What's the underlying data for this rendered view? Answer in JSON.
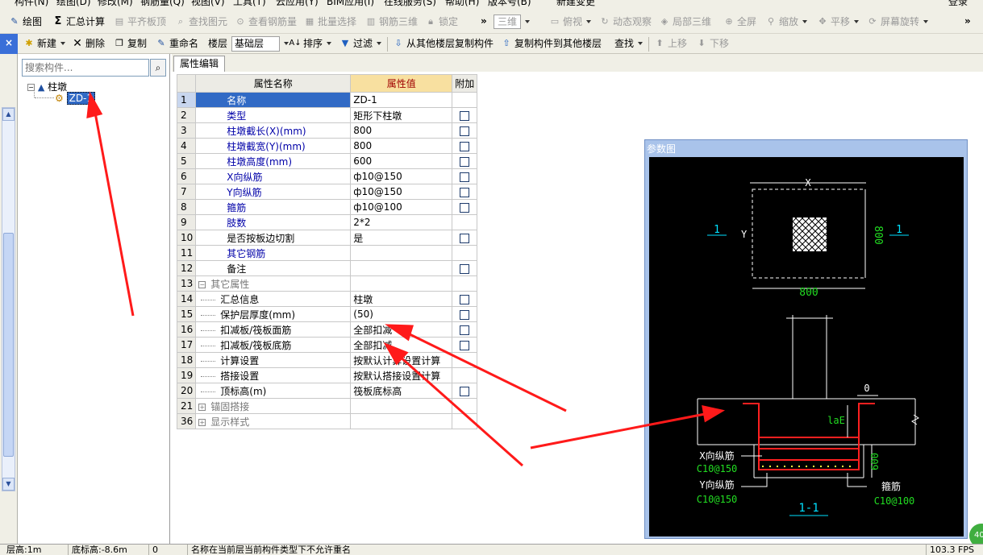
{
  "menubar": {
    "items": [
      "构件(N)",
      "绘图(D)",
      "修改(M)",
      "钢筋量(Q)",
      "视图(V)",
      "工具(T)",
      "云应用(Y)",
      "BIM应用(I)",
      "在线服务(S)",
      "帮助(H)",
      "版本号(B)",
      "新建变更"
    ],
    "login": "登录"
  },
  "toolbar1": {
    "draw": "绘图",
    "sum": "汇总计算",
    "flush_slab": "平齐板顶",
    "find_element": "查找图元",
    "view_rebar": "查看钢筋量",
    "batch_select": "批量选择",
    "rebar_3d": "钢筋三维",
    "lock": "锁定",
    "view_mode": "三维",
    "top_view": "俯视",
    "dyn_view": "动态观察",
    "local_3d": "局部三维",
    "fullscreen": "全屏",
    "zoom": "缩放",
    "pan": "平移",
    "rotate": "屏幕旋转"
  },
  "toolbar2": {
    "new": "新建",
    "delete": "删除",
    "copy": "复制",
    "rename": "重命名",
    "floor_label": "楼层",
    "floor_value": "基础层",
    "sort": "排序",
    "filter": "过滤",
    "copy_from": "从其他楼层复制构件",
    "copy_to": "复制构件到其他楼层",
    "find": "查找",
    "move_up": "上移",
    "move_down": "下移"
  },
  "tree": {
    "search_placeholder": "搜索构件...",
    "root": "柱墩",
    "child": "ZD-1"
  },
  "tab": {
    "label": "属性编辑"
  },
  "grid": {
    "headers": [
      "属性名称",
      "属性值",
      "附加"
    ],
    "rows": [
      {
        "num": "1",
        "name": "名称",
        "value": "ZD-1",
        "blue": true,
        "check": false,
        "sel": true
      },
      {
        "num": "2",
        "name": "类型",
        "value": "矩形下柱墩",
        "blue": true,
        "check": true
      },
      {
        "num": "3",
        "name": "柱墩截长(X)(mm)",
        "value": "800",
        "blue": true,
        "check": true
      },
      {
        "num": "4",
        "name": "柱墩截宽(Y)(mm)",
        "value": "800",
        "blue": true,
        "check": true
      },
      {
        "num": "5",
        "name": "柱墩高度(mm)",
        "value": "600",
        "blue": true,
        "check": true
      },
      {
        "num": "6",
        "name": "X向纵筋",
        "value": "ф10@150",
        "blue": true,
        "check": true
      },
      {
        "num": "7",
        "name": "Y向纵筋",
        "value": "ф10@150",
        "blue": true,
        "check": true
      },
      {
        "num": "8",
        "name": "箍筋",
        "value": "ф10@100",
        "blue": true,
        "check": true
      },
      {
        "num": "9",
        "name": "肢数",
        "value": "2*2",
        "blue": true,
        "check": false
      },
      {
        "num": "10",
        "name": "是否按板边切割",
        "value": "是",
        "blue": false,
        "check": true
      },
      {
        "num": "11",
        "name": "其它钢筋",
        "value": "",
        "blue": true,
        "check": false
      },
      {
        "num": "12",
        "name": "备注",
        "value": "",
        "blue": false,
        "check": true
      },
      {
        "num": "13",
        "name": "其它属性",
        "value": "",
        "group": "minus",
        "gray": true,
        "check": false
      },
      {
        "num": "14",
        "name": "汇总信息",
        "value": "柱墩",
        "child": true,
        "check": true
      },
      {
        "num": "15",
        "name": "保护层厚度(mm)",
        "value": "(50)",
        "child": true,
        "check": true
      },
      {
        "num": "16",
        "name": "扣减板/筏板面筋",
        "value": "全部扣减",
        "child": true,
        "check": true
      },
      {
        "num": "17",
        "name": "扣减板/筏板底筋",
        "value": "全部扣减",
        "child": true,
        "check": true
      },
      {
        "num": "18",
        "name": "计算设置",
        "value": "按默认计算设置计算",
        "child": true,
        "check": false
      },
      {
        "num": "19",
        "name": "搭接设置",
        "value": "按默认搭接设置计算",
        "child": true,
        "check": false
      },
      {
        "num": "20",
        "name": "顶标高(m)",
        "value": "筏板底标高",
        "child": true,
        "check": true
      },
      {
        "num": "21",
        "name": "锚固搭接",
        "value": "",
        "group": "plus",
        "gray": true,
        "check": false
      },
      {
        "num": "36",
        "name": "显示样式",
        "value": "",
        "group": "plus",
        "gray": true,
        "check": false
      }
    ]
  },
  "paramwin": {
    "title": "参数图",
    "plan": {
      "x_label": "X",
      "y_label": "Y",
      "dim_bottom": "800",
      "dim_right": "800",
      "section_left": "1",
      "section_right": "1"
    },
    "section": {
      "zero": "0",
      "lae": "laE",
      "height": "600",
      "x_bar": "X向纵筋",
      "x_bar_spec": "C10@150",
      "y_bar": "Y向纵筋",
      "y_bar_spec": "C10@150",
      "stirrup": "箍筋",
      "stirrup_spec": "C10@100",
      "name": "1-1"
    }
  },
  "statusbar": {
    "floor_height": "层高:1m",
    "base_elev": "底标高:-8.6m",
    "zero": "0",
    "message": "名称在当前层当前构件类型下不允许重名",
    "fps": "103.3 FPS"
  },
  "colors": {
    "accent": "#316ac5",
    "value_header": "#f8e0a0",
    "arrow": "#ff1a1a",
    "rebar": "#ff2020",
    "dim_white": "#ffffff",
    "label_cyan": "#00e0ff",
    "label_green": "#22dd22"
  }
}
